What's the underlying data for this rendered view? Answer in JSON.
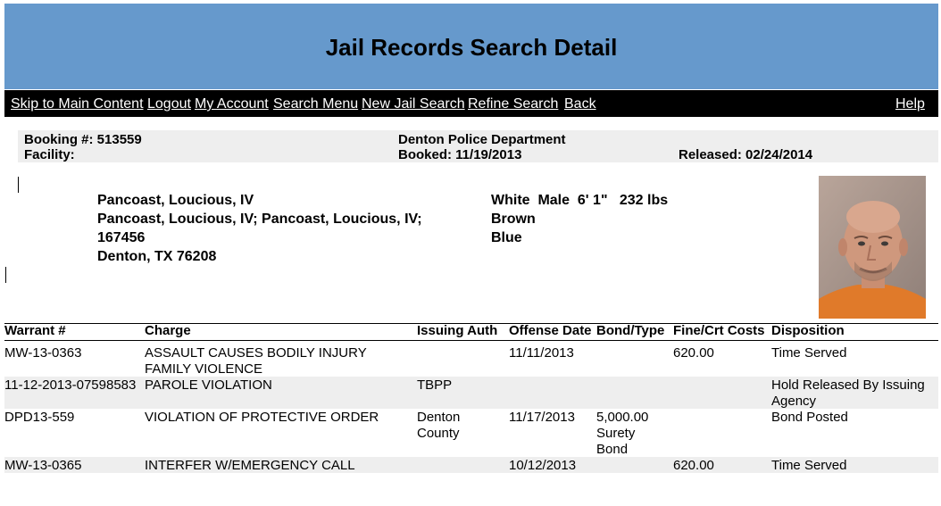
{
  "page_title": "Jail Records Search Detail",
  "nav": {
    "skip": "Skip to Main Content",
    "logout": "Logout",
    "account": "My Account",
    "search_menu": "Search Menu",
    "new_search": "New Jail Search",
    "refine": "Refine Search",
    "back": " Back",
    "help": "Help"
  },
  "booking": {
    "booking_number": "Booking #: 513559",
    "facility": "Facility:",
    "agency": "Denton Police Department",
    "booked": "Booked: 11/19/2013",
    "released": "Released: 02/24/2014"
  },
  "person": {
    "name": "Pancoast, Loucious, IV",
    "aliases": "Pancoast, Loucious, IV; Pancoast, Loucious, IV;",
    "id": "167456",
    "city": "Denton, TX 76208",
    "race_sex_height_weight": "White  Male  6' 1\"   232 lbs",
    "hair": "Brown",
    "eyes": "Blue"
  },
  "charges": {
    "headers": {
      "warrant": "Warrant #",
      "charge": "Charge",
      "issuing": "Issuing Auth",
      "offense_date": "Offense Date",
      "bond": "Bond/Type",
      "fine": "Fine/Crt Costs",
      "disposition": "Disposition"
    },
    "rows": [
      {
        "warrant": "MW-13-0363",
        "charge": "ASSAULT CAUSES BODILY INJURY FAMILY VIOLENCE",
        "issuing": "",
        "offense_date": "11/11/2013",
        "bond": "",
        "fine": "620.00",
        "disposition": "Time Served"
      },
      {
        "warrant": "11-12-2013-07598583",
        "charge": "PAROLE VIOLATION",
        "issuing": "TBPP",
        "offense_date": "",
        "bond": "",
        "fine": "",
        "disposition": "Hold Released By Issuing Agency"
      },
      {
        "warrant": "DPD13-559",
        "charge": "VIOLATION OF PROTECTIVE ORDER",
        "issuing": "Denton County",
        "offense_date": "11/17/2013",
        "bond": "5,000.00 Surety Bond",
        "fine": "",
        "disposition": "Bond Posted"
      },
      {
        "warrant": "MW-13-0365",
        "charge": "INTERFER W/EMERGENCY CALL",
        "issuing": "",
        "offense_date": "10/12/2013",
        "bond": "",
        "fine": "620.00",
        "disposition": "Time Served"
      }
    ]
  }
}
